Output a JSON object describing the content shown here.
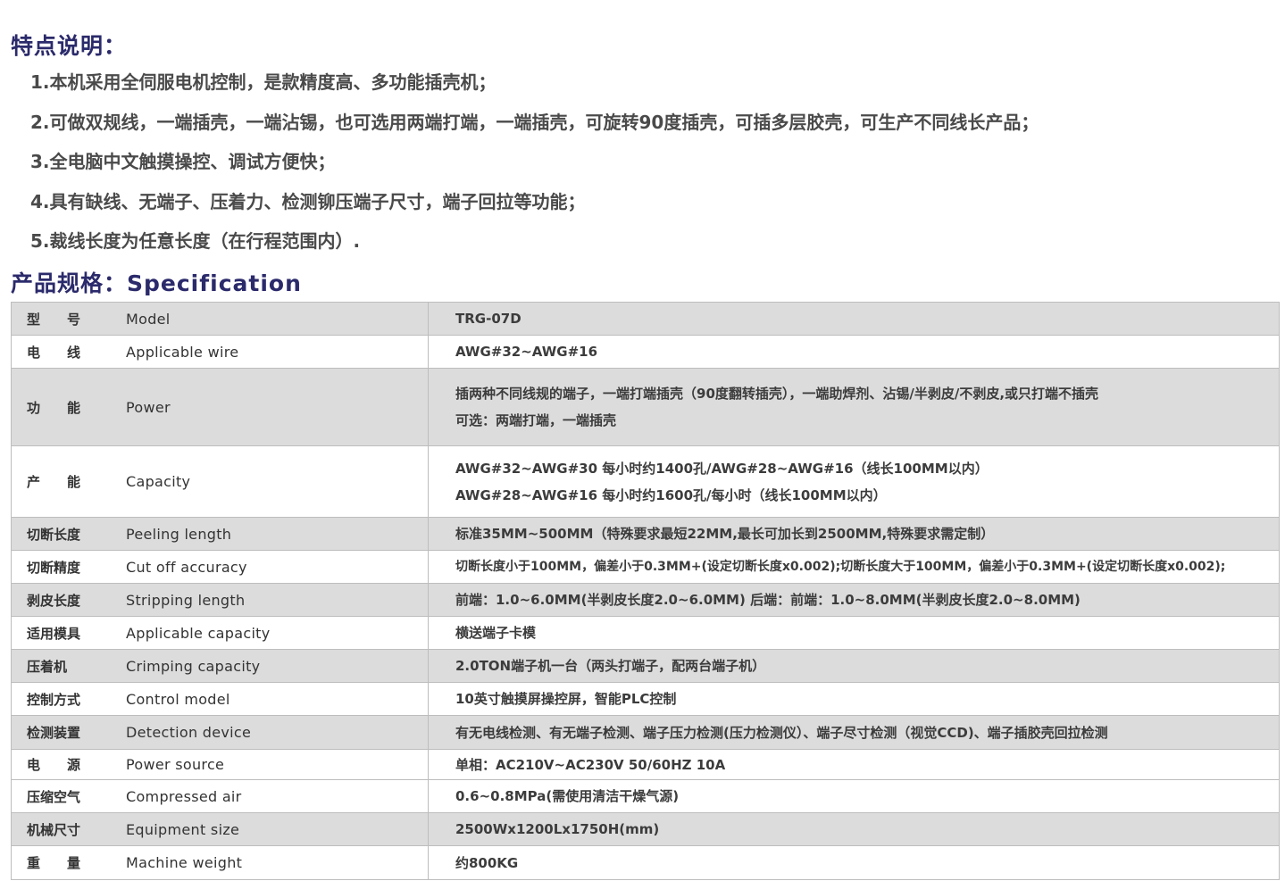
{
  "features": {
    "title": "特点说明：",
    "items": [
      "1.本机采用全伺服电机控制，是款精度高、多功能插壳机；",
      "2.可做双规线，一端插壳，一端沾锡，也可选用两端打端，一端插壳，可旋转90度插壳，可插多层胶壳，可生产不同线长产品；",
      "3.全电脑中文触摸操控、调试方便快；",
      "4.具有缺线、无端子、压着力、检测铆压端子尺寸，端子回拉等功能；",
      "5.裁线长度为任意长度（在行程范围内）."
    ]
  },
  "spec": {
    "title": "产品规格：Specification",
    "rows": [
      {
        "cn": "型　　号",
        "en": "Model",
        "values": [
          "TRG-07D"
        ]
      },
      {
        "cn": "电　　线",
        "en": "Applicable wire",
        "values": [
          "AWG#32~AWG#16"
        ]
      },
      {
        "cn": "功　　能",
        "en": "Power",
        "values": [
          "插两种不同线规的端子，一端打端插壳（90度翻转插壳），一端助焊剂、沾锡/半剥皮/不剥皮,或只打端不插壳",
          "可选：两端打端，一端插壳"
        ]
      },
      {
        "cn": "产　　能",
        "en": "Capacity",
        "values": [
          "AWG#32~AWG#30  每小时约1400孔/AWG#28~AWG#16（线长100MM以内）",
          "AWG#28~AWG#16 每小时约1600孔/每小时（线长100MM以内）"
        ]
      },
      {
        "cn": "切断长度",
        "en": "Peeling length",
        "values": [
          "标准35MM~500MM（特殊要求最短22MM,最长可加长到2500MM,特殊要求需定制）"
        ]
      },
      {
        "cn": "切断精度",
        "en": "Cut off accuracy",
        "values": [
          "切断长度小于100MM，偏差小于0.3MM+(设定切断长度x0.002);切断长度大于100MM，偏差小于0.3MM+(设定切断长度x0.002);"
        ]
      },
      {
        "cn": "剥皮长度",
        "en": "Stripping length",
        "values": [
          "前端：1.0~6.0MM(半剥皮长度2.0~6.0MM) 后端：前端：1.0~8.0MM(半剥皮长度2.0~8.0MM)"
        ]
      },
      {
        "cn": "适用模具",
        "en": "Applicable capacity",
        "values": [
          "横送端子卡模"
        ]
      },
      {
        "cn": "压着机",
        "en": "Crimping capacity",
        "values": [
          "2.0TON端子机一台（两头打端子，配两台端子机）"
        ]
      },
      {
        "cn": "控制方式",
        "en": "Control model",
        "values": [
          "10英寸触摸屏操控屏，智能PLC控制"
        ]
      },
      {
        "cn": "检测装置",
        "en": "Detection device",
        "values": [
          "有无电线检测、有无端子检测、端子压力检测(压力检测仪）、端子尽寸检测（视觉CCD)、端子插胶壳回拉检测"
        ]
      },
      {
        "cn": "电　　源",
        "en": "Power source",
        "values": [
          "单相：AC210V~AC230V  50/60HZ  10A"
        ]
      },
      {
        "cn": "压缩空气",
        "en": "Compressed air",
        "values": [
          "0.6~0.8MPa(需使用清洁干燥气源)"
        ]
      },
      {
        "cn": "机械尺寸",
        "en": "Equipment size",
        "values": [
          "2500Wx1200Lx1750H(mm)"
        ]
      },
      {
        "cn": "重　　量",
        "en": "Machine weight",
        "values": [
          "约800KG"
        ]
      }
    ]
  }
}
